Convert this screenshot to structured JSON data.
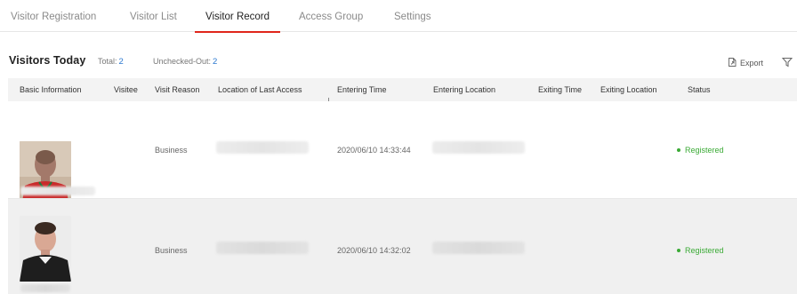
{
  "tabs": [
    {
      "label": "Visitor Registration"
    },
    {
      "label": "Visitor List"
    },
    {
      "label": "Visitor Record",
      "active": true
    },
    {
      "label": "Access Group"
    },
    {
      "label": "Settings"
    }
  ],
  "header": {
    "title": "Visitors Today",
    "total_label": "Total:",
    "total_value": "2",
    "unchecked_label": "Unchecked-Out:",
    "unchecked_value": "2",
    "export_label": "Export",
    "export_icon": "export-icon",
    "filter_icon": "filter-icon"
  },
  "table": {
    "columns": [
      "Basic Information",
      "Visitee",
      "Visit Reason",
      "Location of Last Access",
      "Entering Time",
      "Entering Location",
      "Exiting Time",
      "Exiting Location",
      "Status"
    ],
    "rows": [
      {
        "visitee": "",
        "visit_reason": "Business",
        "entering_time": "2020/06/10 14:33:44",
        "exiting_time": "",
        "exiting_location": "",
        "status": "Registered"
      },
      {
        "visitee": "",
        "visit_reason": "Business",
        "entering_time": "2020/06/10 14:32:02",
        "exiting_time": "",
        "exiting_location": "",
        "status": "Registered"
      }
    ]
  },
  "colors": {
    "accent": "#e0251b",
    "link_blue": "#2b78d0",
    "status_green": "#3aaa35"
  }
}
